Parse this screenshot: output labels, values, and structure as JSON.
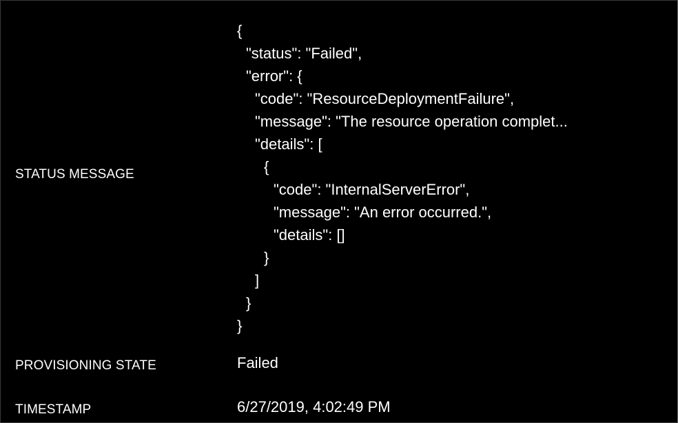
{
  "labels": {
    "status_message": "STATUS MESSAGE",
    "provisioning_state": "PROVISIONING STATE",
    "timestamp": "TIMESTAMP"
  },
  "values": {
    "status_message_json": [
      "{",
      "\"status\": \"Failed\",",
      "\"error\": {",
      "\"code\": \"ResourceDeploymentFailure\",",
      "\"message\": \"The resource operation complet...",
      "\"details\": [",
      "{",
      "\"code\": \"InternalServerError\",",
      "\"message\": \"An error occurred.\",",
      "\"details\": []",
      "}",
      "]",
      "}",
      "}"
    ],
    "provisioning_state": "Failed",
    "timestamp": "6/27/2019, 4:02:49 PM"
  },
  "colors": {
    "background": "#000000",
    "text": "#ffffff"
  }
}
